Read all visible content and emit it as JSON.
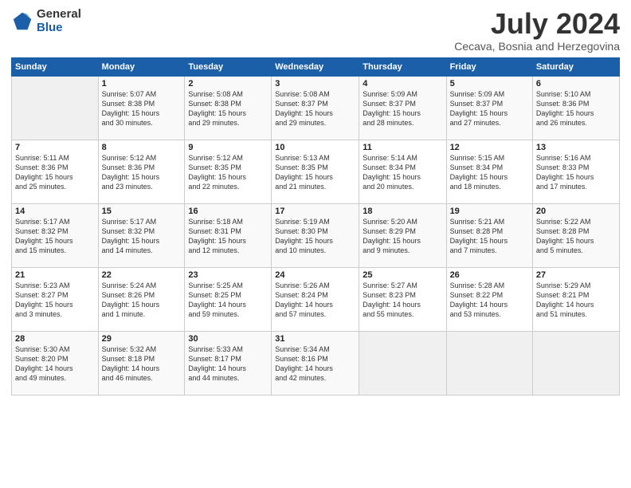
{
  "header": {
    "logo_general": "General",
    "logo_blue": "Blue",
    "month_title": "July 2024",
    "subtitle": "Cecava, Bosnia and Herzegovina"
  },
  "weekdays": [
    "Sunday",
    "Monday",
    "Tuesday",
    "Wednesday",
    "Thursday",
    "Friday",
    "Saturday"
  ],
  "weeks": [
    [
      {
        "day": "",
        "info": ""
      },
      {
        "day": "1",
        "info": "Sunrise: 5:07 AM\nSunset: 8:38 PM\nDaylight: 15 hours\nand 30 minutes."
      },
      {
        "day": "2",
        "info": "Sunrise: 5:08 AM\nSunset: 8:38 PM\nDaylight: 15 hours\nand 29 minutes."
      },
      {
        "day": "3",
        "info": "Sunrise: 5:08 AM\nSunset: 8:37 PM\nDaylight: 15 hours\nand 29 minutes."
      },
      {
        "day": "4",
        "info": "Sunrise: 5:09 AM\nSunset: 8:37 PM\nDaylight: 15 hours\nand 28 minutes."
      },
      {
        "day": "5",
        "info": "Sunrise: 5:09 AM\nSunset: 8:37 PM\nDaylight: 15 hours\nand 27 minutes."
      },
      {
        "day": "6",
        "info": "Sunrise: 5:10 AM\nSunset: 8:36 PM\nDaylight: 15 hours\nand 26 minutes."
      }
    ],
    [
      {
        "day": "7",
        "info": "Sunrise: 5:11 AM\nSunset: 8:36 PM\nDaylight: 15 hours\nand 25 minutes."
      },
      {
        "day": "8",
        "info": "Sunrise: 5:12 AM\nSunset: 8:36 PM\nDaylight: 15 hours\nand 23 minutes."
      },
      {
        "day": "9",
        "info": "Sunrise: 5:12 AM\nSunset: 8:35 PM\nDaylight: 15 hours\nand 22 minutes."
      },
      {
        "day": "10",
        "info": "Sunrise: 5:13 AM\nSunset: 8:35 PM\nDaylight: 15 hours\nand 21 minutes."
      },
      {
        "day": "11",
        "info": "Sunrise: 5:14 AM\nSunset: 8:34 PM\nDaylight: 15 hours\nand 20 minutes."
      },
      {
        "day": "12",
        "info": "Sunrise: 5:15 AM\nSunset: 8:34 PM\nDaylight: 15 hours\nand 18 minutes."
      },
      {
        "day": "13",
        "info": "Sunrise: 5:16 AM\nSunset: 8:33 PM\nDaylight: 15 hours\nand 17 minutes."
      }
    ],
    [
      {
        "day": "14",
        "info": "Sunrise: 5:17 AM\nSunset: 8:32 PM\nDaylight: 15 hours\nand 15 minutes."
      },
      {
        "day": "15",
        "info": "Sunrise: 5:17 AM\nSunset: 8:32 PM\nDaylight: 15 hours\nand 14 minutes."
      },
      {
        "day": "16",
        "info": "Sunrise: 5:18 AM\nSunset: 8:31 PM\nDaylight: 15 hours\nand 12 minutes."
      },
      {
        "day": "17",
        "info": "Sunrise: 5:19 AM\nSunset: 8:30 PM\nDaylight: 15 hours\nand 10 minutes."
      },
      {
        "day": "18",
        "info": "Sunrise: 5:20 AM\nSunset: 8:29 PM\nDaylight: 15 hours\nand 9 minutes."
      },
      {
        "day": "19",
        "info": "Sunrise: 5:21 AM\nSunset: 8:28 PM\nDaylight: 15 hours\nand 7 minutes."
      },
      {
        "day": "20",
        "info": "Sunrise: 5:22 AM\nSunset: 8:28 PM\nDaylight: 15 hours\nand 5 minutes."
      }
    ],
    [
      {
        "day": "21",
        "info": "Sunrise: 5:23 AM\nSunset: 8:27 PM\nDaylight: 15 hours\nand 3 minutes."
      },
      {
        "day": "22",
        "info": "Sunrise: 5:24 AM\nSunset: 8:26 PM\nDaylight: 15 hours\nand 1 minute."
      },
      {
        "day": "23",
        "info": "Sunrise: 5:25 AM\nSunset: 8:25 PM\nDaylight: 14 hours\nand 59 minutes."
      },
      {
        "day": "24",
        "info": "Sunrise: 5:26 AM\nSunset: 8:24 PM\nDaylight: 14 hours\nand 57 minutes."
      },
      {
        "day": "25",
        "info": "Sunrise: 5:27 AM\nSunset: 8:23 PM\nDaylight: 14 hours\nand 55 minutes."
      },
      {
        "day": "26",
        "info": "Sunrise: 5:28 AM\nSunset: 8:22 PM\nDaylight: 14 hours\nand 53 minutes."
      },
      {
        "day": "27",
        "info": "Sunrise: 5:29 AM\nSunset: 8:21 PM\nDaylight: 14 hours\nand 51 minutes."
      }
    ],
    [
      {
        "day": "28",
        "info": "Sunrise: 5:30 AM\nSunset: 8:20 PM\nDaylight: 14 hours\nand 49 minutes."
      },
      {
        "day": "29",
        "info": "Sunrise: 5:32 AM\nSunset: 8:18 PM\nDaylight: 14 hours\nand 46 minutes."
      },
      {
        "day": "30",
        "info": "Sunrise: 5:33 AM\nSunset: 8:17 PM\nDaylight: 14 hours\nand 44 minutes."
      },
      {
        "day": "31",
        "info": "Sunrise: 5:34 AM\nSunset: 8:16 PM\nDaylight: 14 hours\nand 42 minutes."
      },
      {
        "day": "",
        "info": ""
      },
      {
        "day": "",
        "info": ""
      },
      {
        "day": "",
        "info": ""
      }
    ]
  ]
}
